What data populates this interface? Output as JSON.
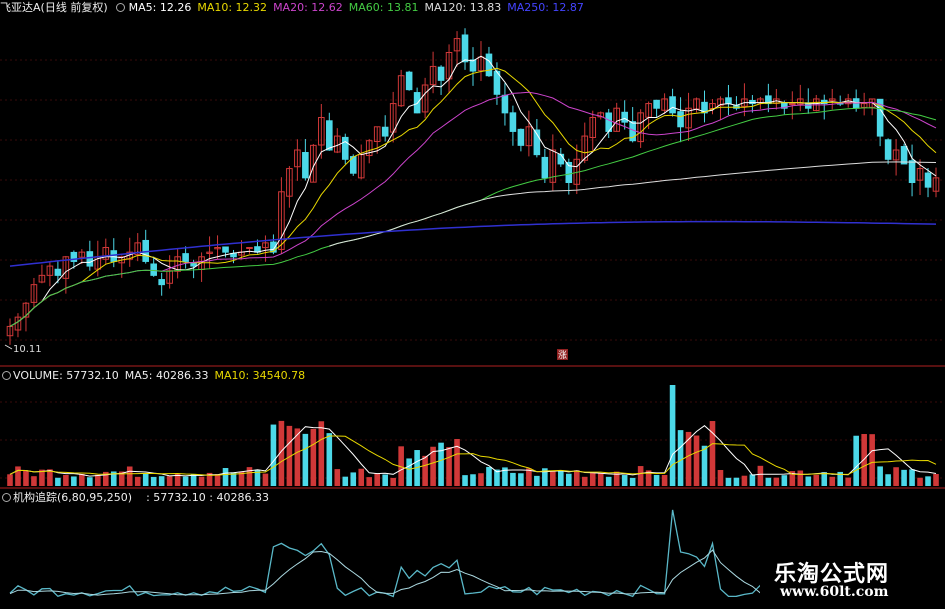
{
  "price_panel": {
    "stock_label": "飞亚达A",
    "period_label": "(日线 前复权)",
    "indicators": [
      {
        "label": "MA5: 12.26",
        "color": "#ffffff"
      },
      {
        "label": "MA10: 12.32",
        "color": "#e8d800"
      },
      {
        "label": "MA20: 12.62",
        "color": "#cc44cc"
      },
      {
        "label": "MA60: 13.81",
        "color": "#44cc44"
      },
      {
        "label": "MA120: 13.83",
        "color": "#dddddd"
      },
      {
        "label": "MA250: 12.87",
        "color": "#4444ff"
      }
    ],
    "low_marker": "10.11",
    "marker_char": "涨"
  },
  "volume_panel": {
    "title": "VOLUME: 57732.10",
    "ma5": "MA5: 40286.33",
    "ma10": "MA10: 34540.78"
  },
  "indicator_panel": {
    "title": "机构追踪(6,80,95,250)",
    "values": ": 57732.10 : 40286.33"
  },
  "watermark": {
    "name": "乐淘公式网",
    "url": "www.60lt.com"
  },
  "colors": {
    "up": "#d03838",
    "down": "#4cd8e8",
    "ma5": "#ffffff",
    "ma10": "#e8d800",
    "ma20": "#cc44cc",
    "ma60": "#44cc44",
    "ma120": "#dddddd",
    "ma250": "#3030d0",
    "divider": "#b02020",
    "indicator": "#5ab8c8"
  },
  "chart_data": {
    "type": "candlestick",
    "y_range": [
      10.0,
      17.0
    ],
    "closes": [
      10.4,
      10.6,
      10.9,
      11.3,
      11.5,
      11.7,
      11.5,
      11.9,
      11.8,
      12.0,
      11.7,
      11.9,
      12.1,
      11.8,
      11.9,
      12.0,
      12.2,
      11.8,
      11.5,
      11.3,
      11.6,
      11.9,
      11.8,
      11.7,
      11.9,
      12.0,
      12.1,
      12.0,
      11.9,
      12.0,
      12.1,
      12.0,
      12.2,
      12.0,
      13.3,
      13.8,
      14.2,
      13.6,
      14.3,
      14.9,
      14.2,
      14.5,
      14.0,
      13.7,
      14.1,
      14.4,
      14.7,
      14.5,
      15.2,
      15.8,
      15.5,
      15.0,
      15.6,
      16.0,
      15.7,
      16.3,
      16.6,
      16.1,
      15.9,
      16.2,
      15.8,
      15.4,
      15.0,
      14.6,
      14.3,
      14.7,
      14.1,
      13.6,
      14.2,
      13.9,
      13.5,
      14.0,
      14.5,
      14.9,
      15.0,
      14.6,
      15.1,
      14.8,
      14.4,
      15.0,
      15.2,
      15.1,
      15.3,
      15.0,
      14.7,
      15.1,
      15.3,
      15.0,
      15.2,
      15.3,
      15.2,
      15.1,
      15.3,
      15.2,
      15.3,
      15.2,
      15.3,
      15.1,
      15.2,
      15.3,
      15.1,
      15.3,
      15.2,
      15.3,
      15.2,
      15.3,
      15.1,
      15.2,
      15.3,
      14.5,
      14.0,
      14.2,
      13.9,
      13.5,
      13.8,
      13.4,
      13.6
    ]
  }
}
